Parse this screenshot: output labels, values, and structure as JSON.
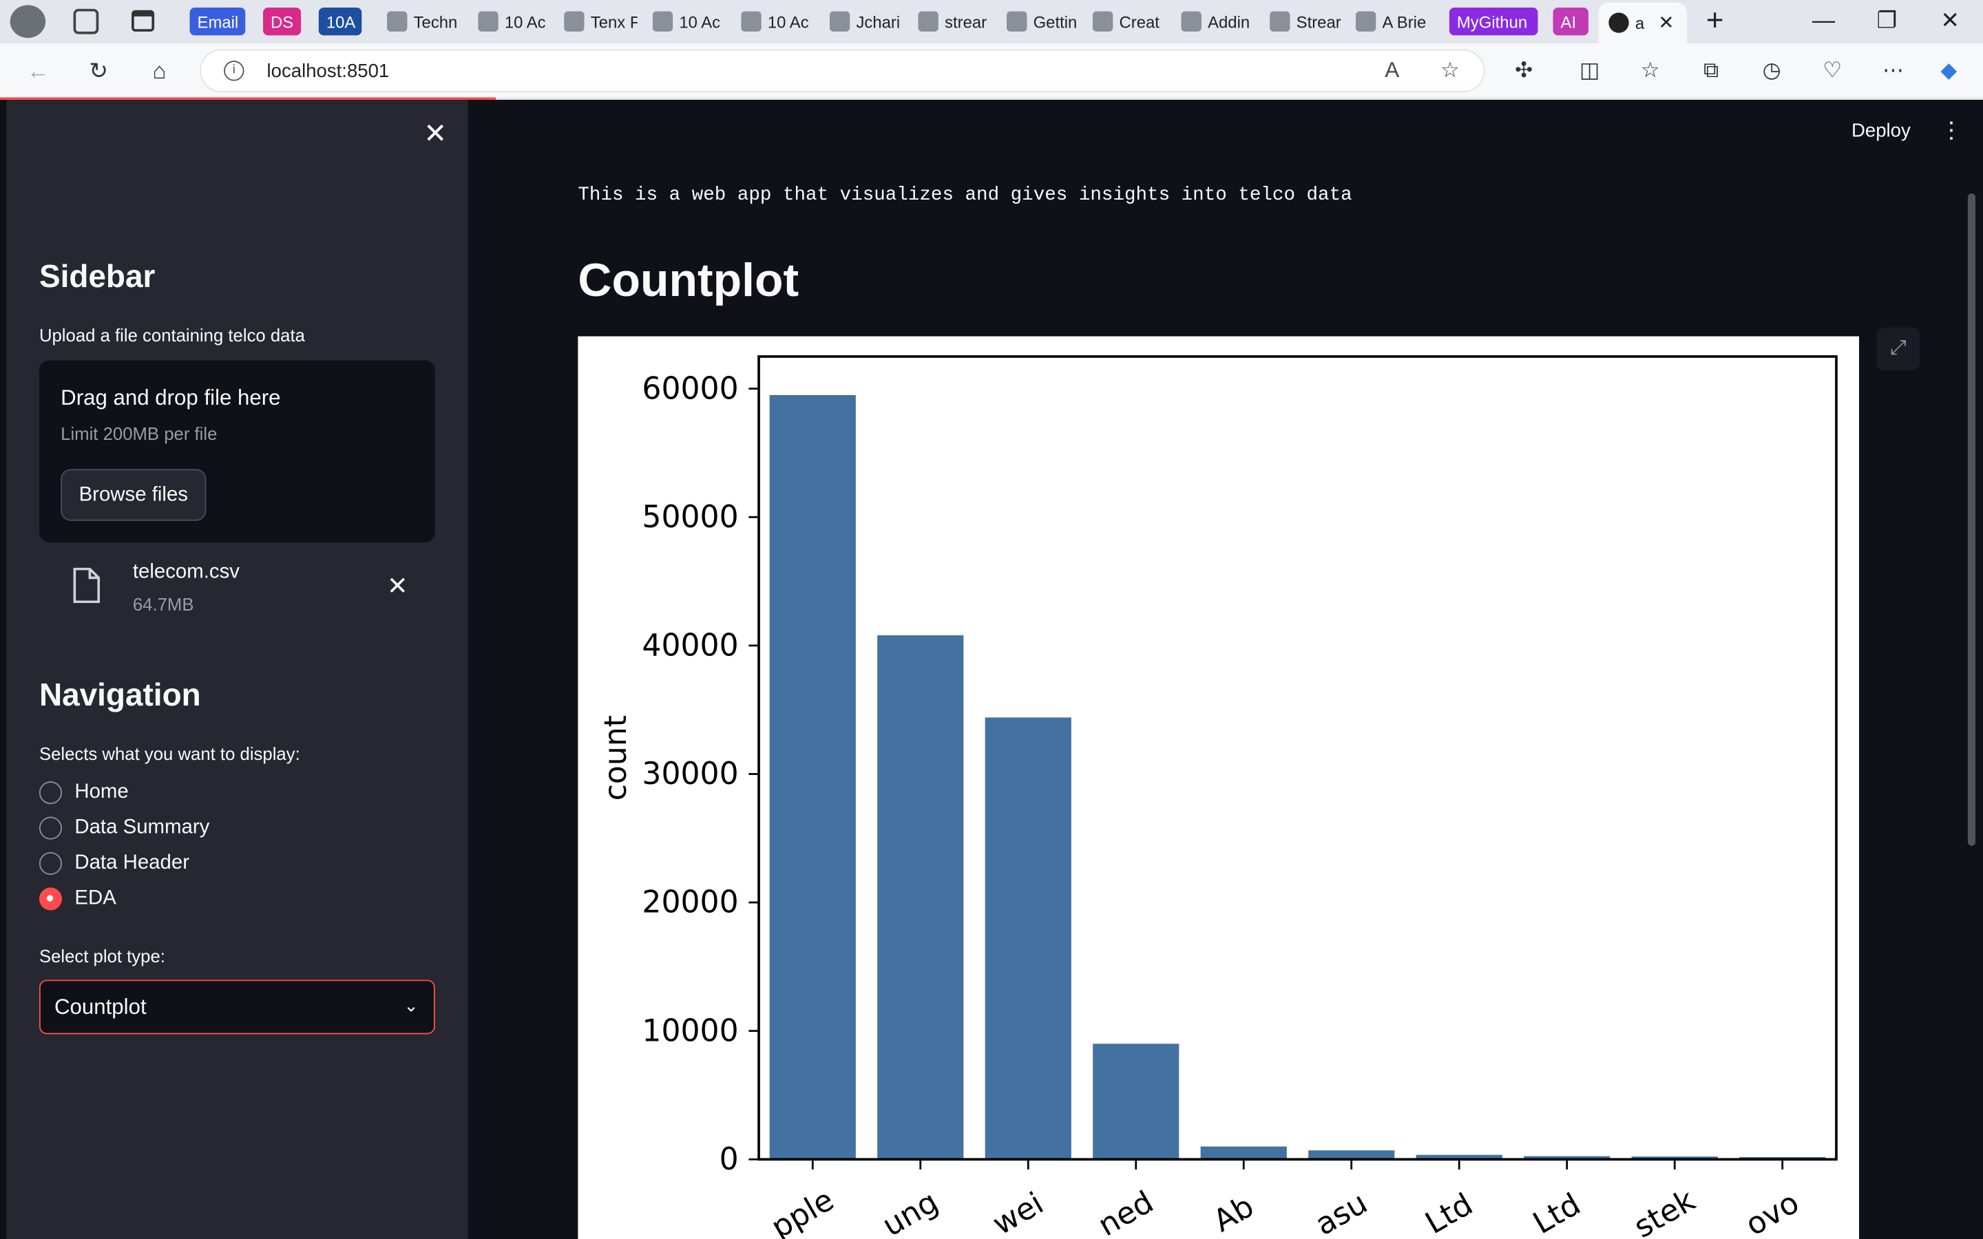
{
  "browser": {
    "tabs": [
      {
        "label": "Email",
        "style": "pill",
        "color": "#3a5ee0"
      },
      {
        "label": "DS",
        "style": "pill",
        "color": "#d72a8a"
      },
      {
        "label": "10A",
        "style": "pill",
        "color": "#1c4fa0"
      },
      {
        "label": "Techn"
      },
      {
        "label": "10 Ac"
      },
      {
        "label": "Tenx F"
      },
      {
        "label": "10 Ac"
      },
      {
        "label": "10 Ac"
      },
      {
        "label": "Jchari"
      },
      {
        "label": "strear"
      },
      {
        "label": "Gettin"
      },
      {
        "label": "Creat"
      },
      {
        "label": "Addin"
      },
      {
        "label": "Strear"
      },
      {
        "label": "A Brie"
      },
      {
        "label": "MyGithun",
        "style": "pill",
        "color": "#8a2be2"
      },
      {
        "label": "AI",
        "style": "pill",
        "color": "#c13bb5"
      }
    ],
    "active_tab_label": "a",
    "address": "localhost:8501"
  },
  "sidebar": {
    "title": "Sidebar",
    "upload_label": "Upload a file containing telco data",
    "dropzone_title": "Drag and drop file here",
    "dropzone_limit": "Limit 200MB per file",
    "browse_label": "Browse files",
    "file": {
      "name": "telecom.csv",
      "size": "64.7MB"
    },
    "nav_title": "Navigation",
    "nav_label": "Selects what you want to display:",
    "radio_options": [
      {
        "label": "Home",
        "selected": false
      },
      {
        "label": "Data Summary",
        "selected": false
      },
      {
        "label": "Data Header",
        "selected": false
      },
      {
        "label": "EDA",
        "selected": true
      }
    ],
    "plot_type_label": "Select plot type:",
    "plot_type_value": "Countplot"
  },
  "main": {
    "deploy_label": "Deploy",
    "intro_text": "This is a web app that visualizes and gives insights into telco data",
    "heading": "Countplot"
  },
  "chart_data": {
    "type": "bar",
    "categories": [
      "pple",
      "ung",
      "wei",
      "ned",
      "Ab",
      "asu",
      "Ltd",
      "Ltd",
      "stek",
      "ovo"
    ],
    "values": [
      59500,
      40800,
      34400,
      9000,
      1000,
      700,
      350,
      250,
      220,
      180
    ],
    "xlabel": "",
    "ylabel": "count",
    "ylim": [
      0,
      62500
    ],
    "yticks": [
      0,
      10000,
      20000,
      30000,
      40000,
      50000,
      60000
    ],
    "bar_color": "#4472a0",
    "grid": false
  }
}
